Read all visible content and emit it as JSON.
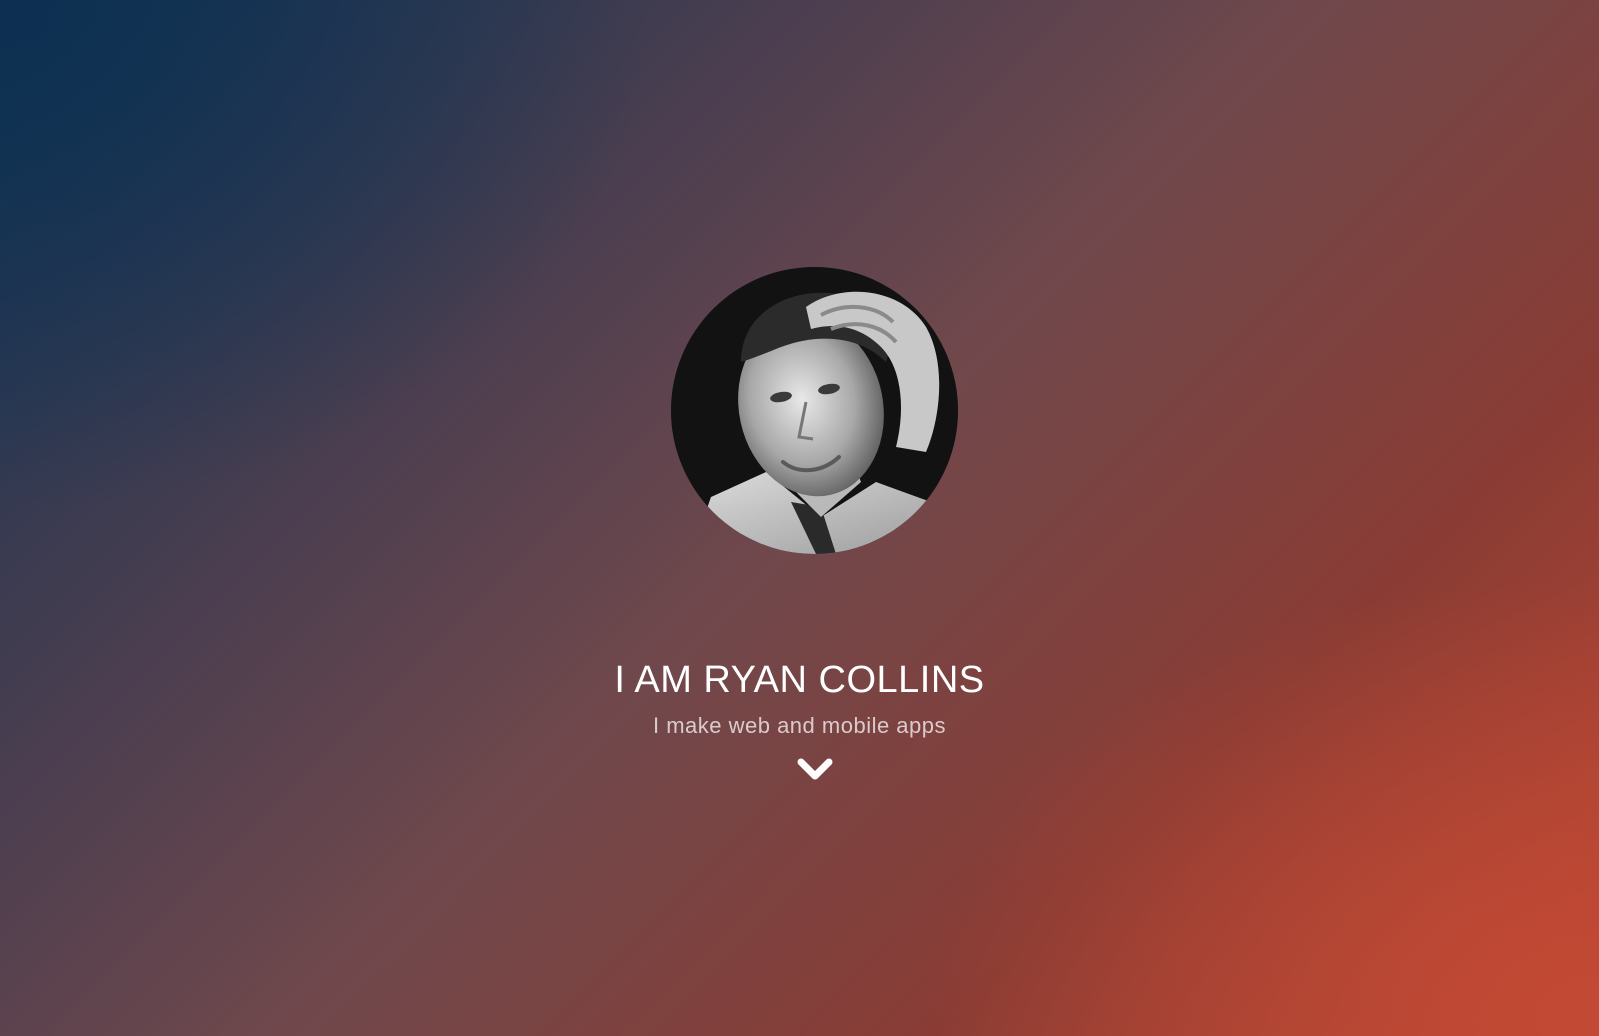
{
  "hero": {
    "avatar_alt": "Ryan Collins",
    "title": "I AM RYAN COLLINS",
    "subtitle": "I make web and mobile apps",
    "scroll_icon": "chevron-down-icon"
  },
  "colors": {
    "top_left": "#113353",
    "bottom_right": "#bd4734",
    "text": "#ffffff"
  }
}
